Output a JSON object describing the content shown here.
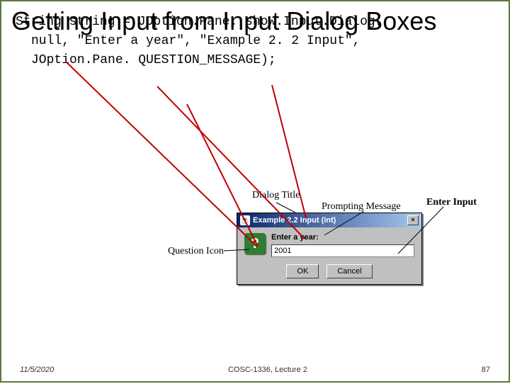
{
  "title": "Getting Input from Input Dialog Boxes",
  "code": {
    "line1": "String string = JOption.Pane. show.Input.Dialog(",
    "line2": "null, \"Enter a year\", \"Example 2. 2 Input\",",
    "line3": "JOption.Pane. QUESTION_MESSAGE);"
  },
  "labels": {
    "dialog_title": "Dialog Title",
    "prompting": "Prompting Message",
    "enter_input": "Enter Input",
    "question_icon": "Question Icon"
  },
  "dialog": {
    "title": "Example 2.2 Input (int)",
    "prompt": "Enter a year:",
    "input_value": "2001",
    "ok": "OK",
    "cancel": "Cancel",
    "question_glyph": "?",
    "close_glyph": "×",
    "java_glyph": "☕"
  },
  "footer": {
    "date": "11/5/2020",
    "center": "COSC-1336, Lecture 2",
    "page": "87"
  }
}
